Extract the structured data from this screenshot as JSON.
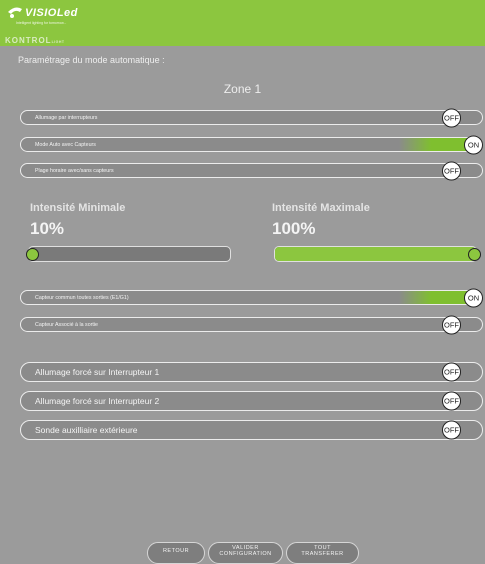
{
  "header": {
    "brand_name": "VISIOLed",
    "brand_tagline": "Intelligent lighting for tomorrow...",
    "product_name": "KONTROL",
    "product_suffix": "LIGHT",
    "brand_color": "#8cc63f"
  },
  "page": {
    "title": "Paramétrage du mode automatique :",
    "zone": "Zone 1"
  },
  "toggles_top": [
    {
      "label": "Allumage par interrupteurs",
      "state": "OFF"
    },
    {
      "label": "Mode Auto avec Capteurs",
      "state": "ON"
    },
    {
      "label": "Plage horaire avec/sans capteurs",
      "state": "OFF"
    }
  ],
  "intensity": {
    "min": {
      "label": "Intensité Minimale",
      "value": "10%",
      "level": 0
    },
    "max": {
      "label": "Intensité Maximale",
      "value": "100%",
      "level": 1
    }
  },
  "toggles_sensor": [
    {
      "label": "Capteur commun toutes sorties (E1/G1)",
      "state": "ON"
    },
    {
      "label": "Capteur Associé à la sortie",
      "state": "OFF"
    }
  ],
  "toggles_forced": [
    {
      "label": "Allumage forcé sur Interrupteur 1",
      "state": "OFF"
    },
    {
      "label": "Allumage forcé sur Interrupteur 2",
      "state": "OFF"
    },
    {
      "label": "Sonde auxilliaire extérieure",
      "state": "OFF"
    }
  ],
  "buttons": {
    "back": "RETOUR",
    "validate_line1": "VALIDER",
    "validate_line2": "CONFIGURATION",
    "transfer_line1": "TOUT",
    "transfer_line2": "TRANSFERER"
  }
}
